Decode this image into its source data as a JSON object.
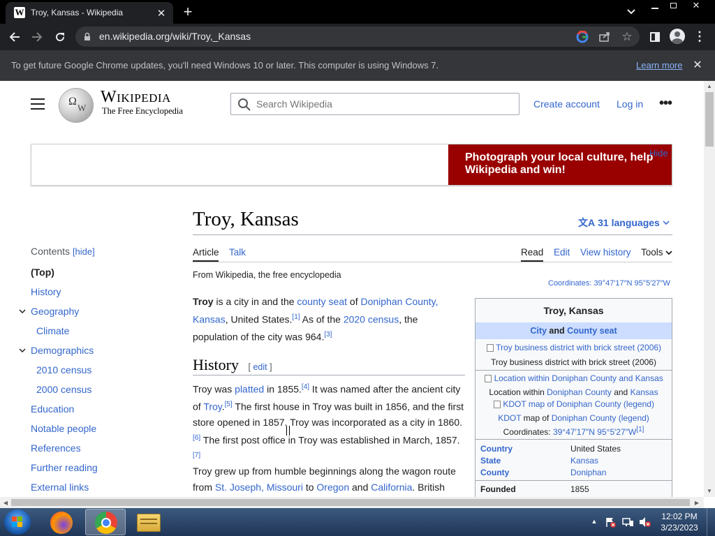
{
  "browser": {
    "tab_title": "Troy, Kansas - Wikipedia",
    "tab_favicon": "W",
    "url": "en.wikipedia.org/wiki/Troy,_Kansas",
    "infobar_text": "To get future Google Chrome updates, you'll need Windows 10 or later. This computer is using Windows 7.",
    "infobar_link": "Learn more"
  },
  "header": {
    "wordmark": "Wikipedia",
    "tagline": "The Free Encyclopedia",
    "search_placeholder": "Search Wikipedia",
    "create_account": "Create account",
    "log_in": "Log in"
  },
  "banner": {
    "text": "Photograph your local culture, help Wikipedia and win!",
    "hide": "Hide",
    "color": "#990000"
  },
  "toc": {
    "heading": "Contents",
    "hide": "[hide]",
    "items": [
      "(Top)",
      "History",
      "Geography",
      "Climate",
      "Demographics",
      "2010 census",
      "2000 census",
      "Education",
      "Notable people",
      "References",
      "Further reading",
      "External links"
    ]
  },
  "article": {
    "title": "Troy, Kansas",
    "languages": "31 languages",
    "tabs": {
      "article": "Article",
      "talk": "Talk",
      "read": "Read",
      "edit": "Edit",
      "history": "View history",
      "tools": "Tools"
    },
    "from": "From Wikipedia, the free encyclopedia",
    "coordinates_label": "Coordinates:",
    "coordinates": "39°47′17″N 95°5′27″W",
    "lead": {
      "b": "Troy",
      "t1": " is a city in and the ",
      "l1": "county seat",
      "t2": " of ",
      "l2": "Doniphan County, Kansas",
      "t3": ", United States.",
      "r1": "[1]",
      "t4": " As of the ",
      "l3": "2020 census",
      "t5": ", the population of the city was 964.",
      "r3": "[3]"
    },
    "history_heading": "History",
    "edit": "edit",
    "hist_p1": {
      "t1": "Troy was ",
      "l1": "platted",
      "t2": " in 1855.",
      "r4": "[4]",
      "t3": " It was named after the ancient city of ",
      "l2": "Troy",
      "t4": ".",
      "r5": "[5]",
      "t5": " The first house in Troy was built in 1856, and the first store opened in 1857. Troy was incorporated as a city in 1860.",
      "r6": "[6]",
      "t6": " The first post office in Troy was established in March, 1857.",
      "r7": "[7]"
    },
    "hist_p2": {
      "t1": "Troy grew up from humble beginnings along the wagon route from ",
      "l1": "St. Joseph, Missouri",
      "t2": " to ",
      "l2": "Oregon",
      "t3": " and ",
      "l3": "California",
      "t4": ". British"
    }
  },
  "infobox": {
    "title": "Troy, Kansas",
    "sub_l1": "City",
    "sub_and": " and ",
    "sub_l2": "County seat",
    "img1_alt": "Troy business district with brick street (2006)",
    "img1_caption": "Troy business district with brick street (2006)",
    "img2_alt": "Location within Doniphan County and Kansas",
    "img2_cap_t1": "Location within ",
    "img2_cap_l1": "Doniphan County",
    "img2_cap_t2": " and ",
    "img2_cap_l2": "Kansas",
    "img3_alt": "KDOT map of Doniphan County (legend)",
    "img3_cap_l1": "KDOT",
    "img3_cap_t1": " map of ",
    "img3_cap_l2": "Doniphan County",
    "img3_cap_l3": "(legend)",
    "coords_label": "Coordinates:",
    "coords": "39°47′17″N 95°5′27″W",
    "coords_ref": "[1]",
    "rows": [
      {
        "k": "Country",
        "v": "United States",
        "vlink": false
      },
      {
        "k": "State",
        "v": "Kansas",
        "vlink": true
      },
      {
        "k": "County",
        "v": "Doniphan",
        "vlink": true
      }
    ],
    "founded_k": "Founded",
    "founded_v": "1855"
  },
  "taskbar": {
    "time": "12:02 PM",
    "date": "3/23/2023"
  }
}
